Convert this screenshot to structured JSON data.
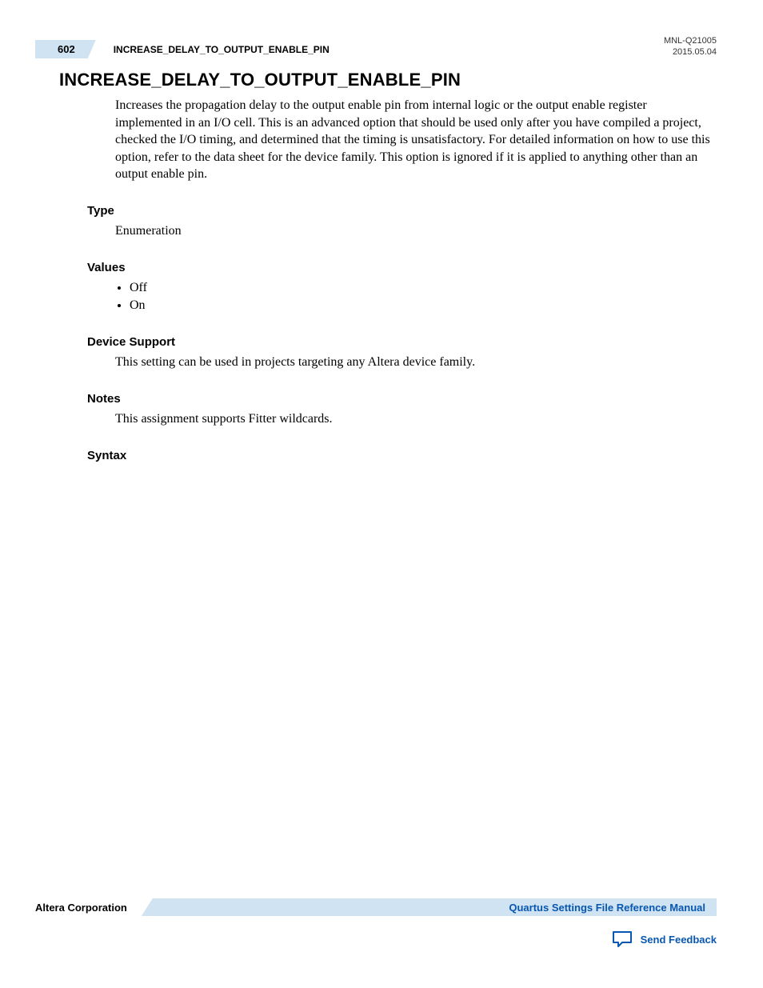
{
  "header": {
    "page_number": "602",
    "section_name": "INCREASE_DELAY_TO_OUTPUT_ENABLE_PIN",
    "doc_id": "MNL-Q21005",
    "doc_date": "2015.05.04"
  },
  "main": {
    "heading": "INCREASE_DELAY_TO_OUTPUT_ENABLE_PIN",
    "description": "Increases the propagation delay to the output enable pin from internal logic or the output enable register implemented in an I/O cell. This is an advanced option that should be used only after you have compiled a project, checked the I/O timing, and determined that the timing is unsatisfactory. For detailed information on how to use this option, refer to the data sheet for the device family. This option is ignored if it is applied to anything other than an output enable pin.",
    "sections": {
      "type": {
        "label": "Type",
        "text": "Enumeration"
      },
      "values": {
        "label": "Values",
        "items": [
          "Off",
          "On"
        ]
      },
      "device_support": {
        "label": "Device Support",
        "text": "This setting can be used in projects targeting any Altera device family."
      },
      "notes": {
        "label": "Notes",
        "text": "This assignment supports Fitter wildcards."
      },
      "syntax": {
        "label": "Syntax"
      }
    }
  },
  "footer": {
    "company": "Altera Corporation",
    "manual_link": "Quartus Settings File Reference Manual",
    "feedback_link": "Send Feedback"
  }
}
